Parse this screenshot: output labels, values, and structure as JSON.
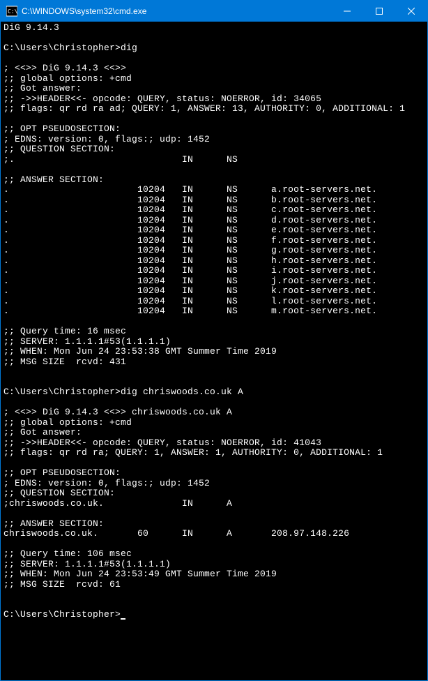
{
  "titlebar": {
    "title": "C:\\WINDOWS\\system32\\cmd.exe"
  },
  "terminal": {
    "line1": "DiG 9.14.3",
    "line2": "",
    "prompt1": "C:\\Users\\Christopher>dig",
    "line4": "",
    "q1": {
      "banner": "; <<>> DiG 9.14.3 <<>>",
      "globalopts": ";; global options: +cmd",
      "gotanswer": ";; Got answer:",
      "header": ";; ->>HEADER<<- opcode: QUERY, status: NOERROR, id: 34065",
      "flags": ";; flags: qr rd ra ad; QUERY: 1, ANSWER: 13, AUTHORITY: 0, ADDITIONAL: 1",
      "blank1": "",
      "optpseudo": ";; OPT PSEUDOSECTION:",
      "edns": "; EDNS: version: 0, flags:; udp: 1452",
      "questionhdr": ";; QUESTION SECTION:",
      "question": ";.                              IN      NS",
      "blank2": "",
      "answerhdr": ";; ANSWER SECTION:",
      "ans": [
        ".                       10204   IN      NS      a.root-servers.net.",
        ".                       10204   IN      NS      b.root-servers.net.",
        ".                       10204   IN      NS      c.root-servers.net.",
        ".                       10204   IN      NS      d.root-servers.net.",
        ".                       10204   IN      NS      e.root-servers.net.",
        ".                       10204   IN      NS      f.root-servers.net.",
        ".                       10204   IN      NS      g.root-servers.net.",
        ".                       10204   IN      NS      h.root-servers.net.",
        ".                       10204   IN      NS      i.root-servers.net.",
        ".                       10204   IN      NS      j.root-servers.net.",
        ".                       10204   IN      NS      k.root-servers.net.",
        ".                       10204   IN      NS      l.root-servers.net.",
        ".                       10204   IN      NS      m.root-servers.net."
      ],
      "blank3": "",
      "qtime": ";; Query time: 16 msec",
      "server": ";; SERVER: 1.1.1.1#53(1.1.1.1)",
      "when": ";; WHEN: Mon Jun 24 23:53:38 GMT Summer Time 2019",
      "msgsize": ";; MSG SIZE  rcvd: 431"
    },
    "blankA": "",
    "blankB": "",
    "prompt2": "C:\\Users\\Christopher>dig chriswoods.co.uk A",
    "blankC": "",
    "q2": {
      "banner": "; <<>> DiG 9.14.3 <<>> chriswoods.co.uk A",
      "globalopts": ";; global options: +cmd",
      "gotanswer": ";; Got answer:",
      "header": ";; ->>HEADER<<- opcode: QUERY, status: NOERROR, id: 41043",
      "flags": ";; flags: qr rd ra; QUERY: 1, ANSWER: 1, AUTHORITY: 0, ADDITIONAL: 1",
      "blank1": "",
      "optpseudo": ";; OPT PSEUDOSECTION:",
      "edns": "; EDNS: version: 0, flags:; udp: 1452",
      "questionhdr": ";; QUESTION SECTION:",
      "question": ";chriswoods.co.uk.              IN      A",
      "blank2": "",
      "answerhdr": ";; ANSWER SECTION:",
      "ans": [
        "chriswoods.co.uk.       60      IN      A       208.97.148.226"
      ],
      "blank3": "",
      "qtime": ";; Query time: 106 msec",
      "server": ";; SERVER: 1.1.1.1#53(1.1.1.1)",
      "when": ";; WHEN: Mon Jun 24 23:53:49 GMT Summer Time 2019",
      "msgsize": ";; MSG SIZE  rcvd: 61"
    },
    "blankD": "",
    "blankE": "",
    "prompt3": "C:\\Users\\Christopher>"
  }
}
